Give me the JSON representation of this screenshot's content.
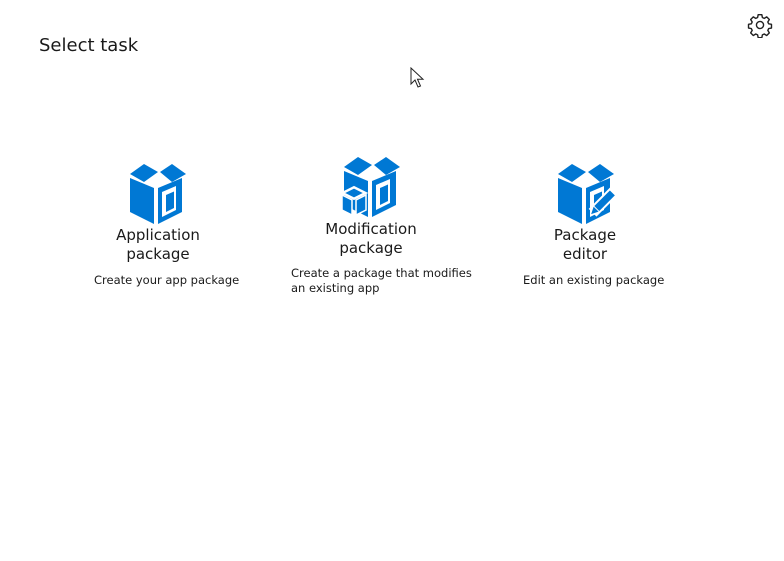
{
  "page": {
    "title": "Select task"
  },
  "icons": {
    "settings": "gear-icon",
    "cursor": "mouse-pointer-icon",
    "accent": "#0078d4"
  },
  "tiles": [
    {
      "title_line1": "Application",
      "title_line2": "package",
      "description": "Create your app package",
      "icon": "box-icon"
    },
    {
      "title_line1": "Modification",
      "title_line2": "package",
      "description_line1": "Create a package that modifies",
      "description_line2": "an existing app",
      "icon": "box-modify-icon"
    },
    {
      "title_line1": "Package",
      "title_line2": "editor",
      "description": "Edit an existing package",
      "icon": "box-edit-icon"
    }
  ]
}
